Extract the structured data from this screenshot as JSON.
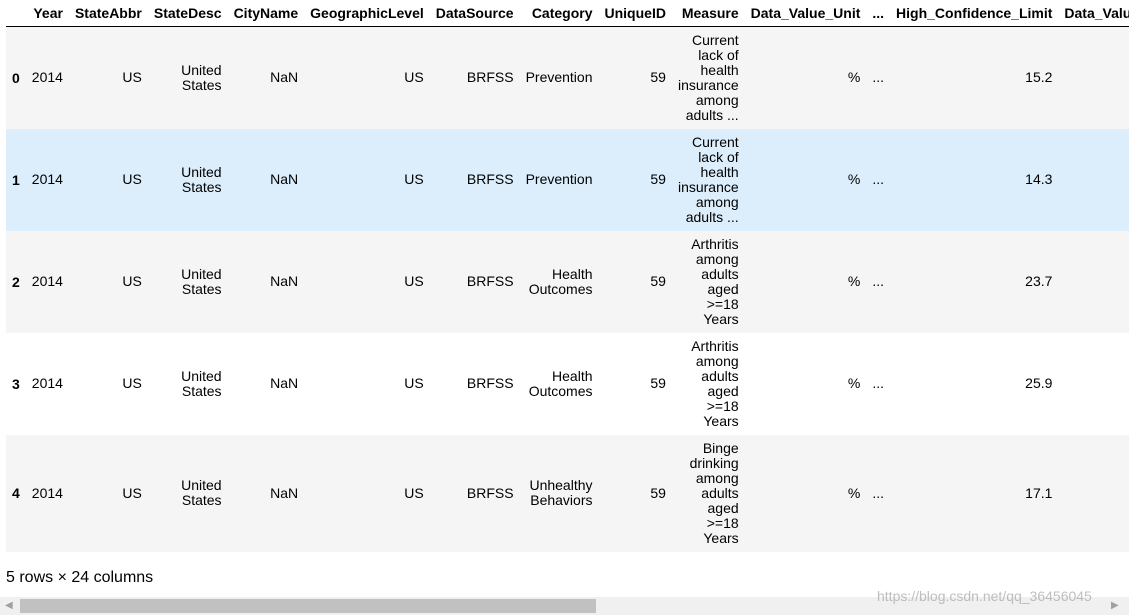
{
  "columns": [
    "",
    "Year",
    "StateAbbr",
    "StateDesc",
    "CityName",
    "GeographicLevel",
    "DataSource",
    "Category",
    "UniqueID",
    "Measure",
    "Data_Value_Unit",
    "...",
    "High_Confidence_Limit",
    "Data_Valu"
  ],
  "rows": [
    {
      "idx": "0",
      "year": "2014",
      "abbr": "US",
      "desc": "United States",
      "city": "NaN",
      "geo": "US",
      "src": "BRFSS",
      "cat": "Prevention",
      "uid": "59",
      "measure": "Current lack of health insurance among adults ...",
      "unit": "%",
      "ell": "...",
      "hcl": "15.2"
    },
    {
      "idx": "1",
      "year": "2014",
      "abbr": "US",
      "desc": "United States",
      "city": "NaN",
      "geo": "US",
      "src": "BRFSS",
      "cat": "Prevention",
      "uid": "59",
      "measure": "Current lack of health insurance among adults ...",
      "unit": "%",
      "ell": "...",
      "hcl": "14.3"
    },
    {
      "idx": "2",
      "year": "2014",
      "abbr": "US",
      "desc": "United States",
      "city": "NaN",
      "geo": "US",
      "src": "BRFSS",
      "cat": "Health Outcomes",
      "uid": "59",
      "measure": "Arthritis among adults aged >=18 Years",
      "unit": "%",
      "ell": "...",
      "hcl": "23.7"
    },
    {
      "idx": "3",
      "year": "2014",
      "abbr": "US",
      "desc": "United States",
      "city": "NaN",
      "geo": "US",
      "src": "BRFSS",
      "cat": "Health Outcomes",
      "uid": "59",
      "measure": "Arthritis among adults aged >=18 Years",
      "unit": "%",
      "ell": "...",
      "hcl": "25.9"
    },
    {
      "idx": "4",
      "year": "2014",
      "abbr": "US",
      "desc": "United States",
      "city": "NaN",
      "geo": "US",
      "src": "BRFSS",
      "cat": "Unhealthy Behaviors",
      "uid": "59",
      "measure": "Binge drinking among adults aged >=18 Years",
      "unit": "%",
      "ell": "...",
      "hcl": "17.1"
    }
  ],
  "footer": "5 rows × 24 columns",
  "watermark": "https://blog.csdn.net/qq_36456045"
}
